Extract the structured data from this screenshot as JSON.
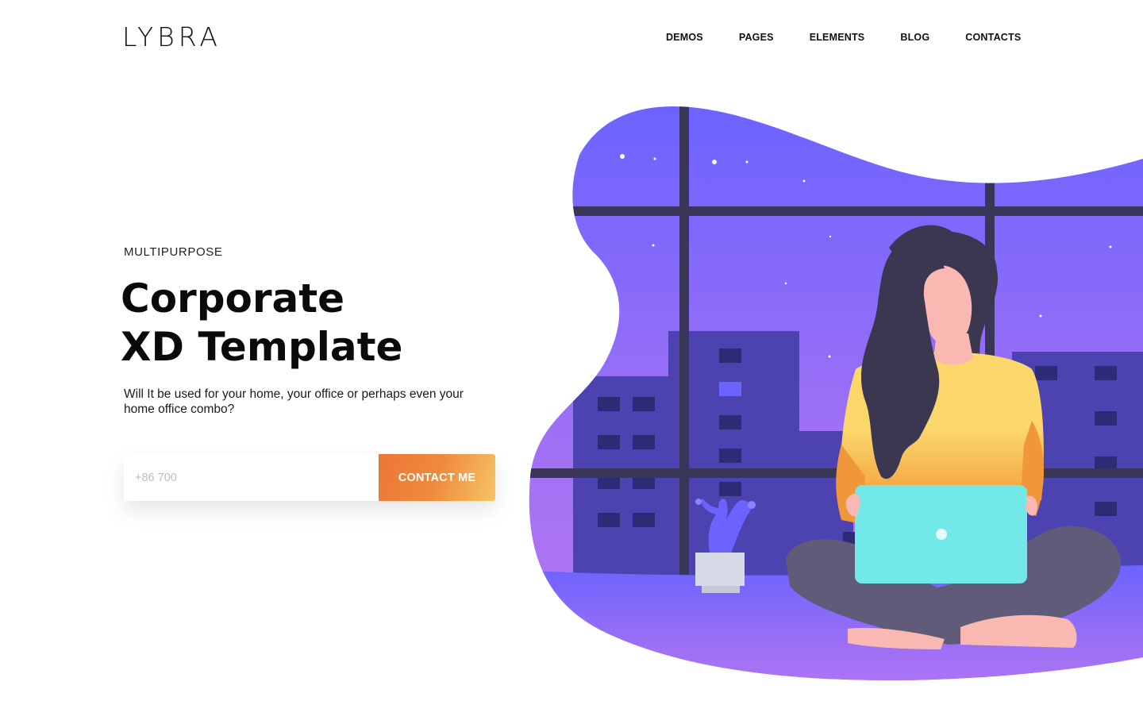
{
  "header": {
    "logo": "LYBRA",
    "nav": [
      "DEMOS",
      "PAGES",
      "ELEMENTS",
      "BLOG",
      "CONTACTS"
    ]
  },
  "hero": {
    "eyebrow": "MULTIPURPOSE",
    "title_line1": "Corporate",
    "title_line2": "XD Template",
    "description": "Will It be used for your home, your office or perhaps even your home office combo?",
    "phone_placeholder": "+86 700",
    "cta_label": "CONTACT ME"
  },
  "colors": {
    "accent_orange": "#ec7638",
    "accent_yellow": "#f6c566",
    "blob_top": "#6c63ff",
    "blob_bottom": "#b877f2",
    "laptop": "#72e8e8"
  }
}
